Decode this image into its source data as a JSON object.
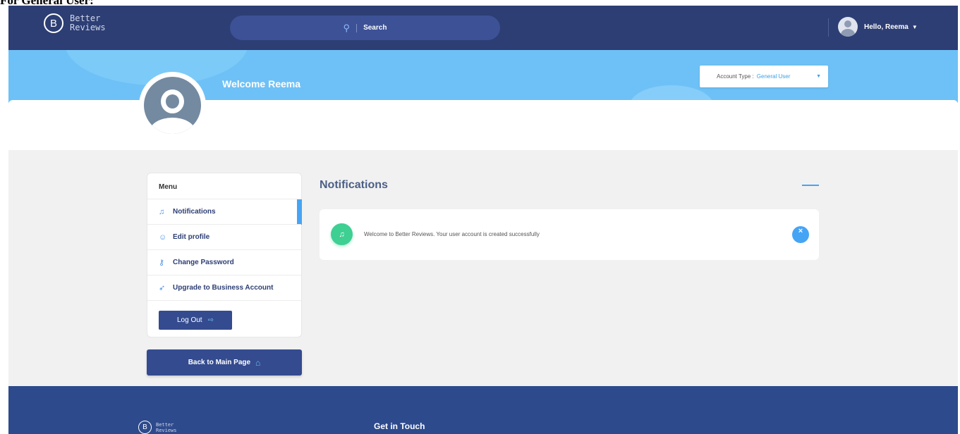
{
  "caption": "For General User:",
  "header": {
    "logo_letter": "B",
    "logo_line1": "Better",
    "logo_line2": "Reviews",
    "search_icon": "search-icon",
    "search_label": "Search",
    "greeting": "Hello, Reema",
    "user_caret": "▼"
  },
  "banner": {
    "welcome": "Welcome Reema",
    "account_type_label": "Account Type :",
    "account_type_value": "General User",
    "account_type_caret": "▼"
  },
  "menu": {
    "title": "Menu",
    "items": [
      {
        "label": "Notifications",
        "icon": "bell-icon",
        "glyph": "♫"
      },
      {
        "label": "Edit profile",
        "icon": "user-edit-icon",
        "glyph": "☺"
      },
      {
        "label": "Change Password",
        "icon": "key-icon",
        "glyph": "⚷"
      },
      {
        "label": "Upgrade to Business Account",
        "icon": "rocket-icon",
        "glyph": "➶"
      }
    ],
    "logout_label": "Log Out",
    "logout_icon": "⇨"
  },
  "back_button": {
    "label": "Back to Main Page",
    "icon": "⌂"
  },
  "notifications": {
    "title": "Notifications",
    "items": [
      {
        "message": "Welcome to Better Reviews. Your user account is created successfully",
        "badge_icon": "🔔",
        "dismiss_icon": "×"
      }
    ]
  },
  "footer": {
    "logo_letter": "B",
    "logo_line1": "Better",
    "logo_line2": "Reviews",
    "heading": "Get in Touch"
  },
  "colors": {
    "header_bg": "#2d3e74",
    "banner_bg": "#6ec1f6",
    "accent_blue": "#46a4f5",
    "button_navy": "#344b8f",
    "success_green": "#3ecf93",
    "footer_bg": "#2d4a8c"
  }
}
